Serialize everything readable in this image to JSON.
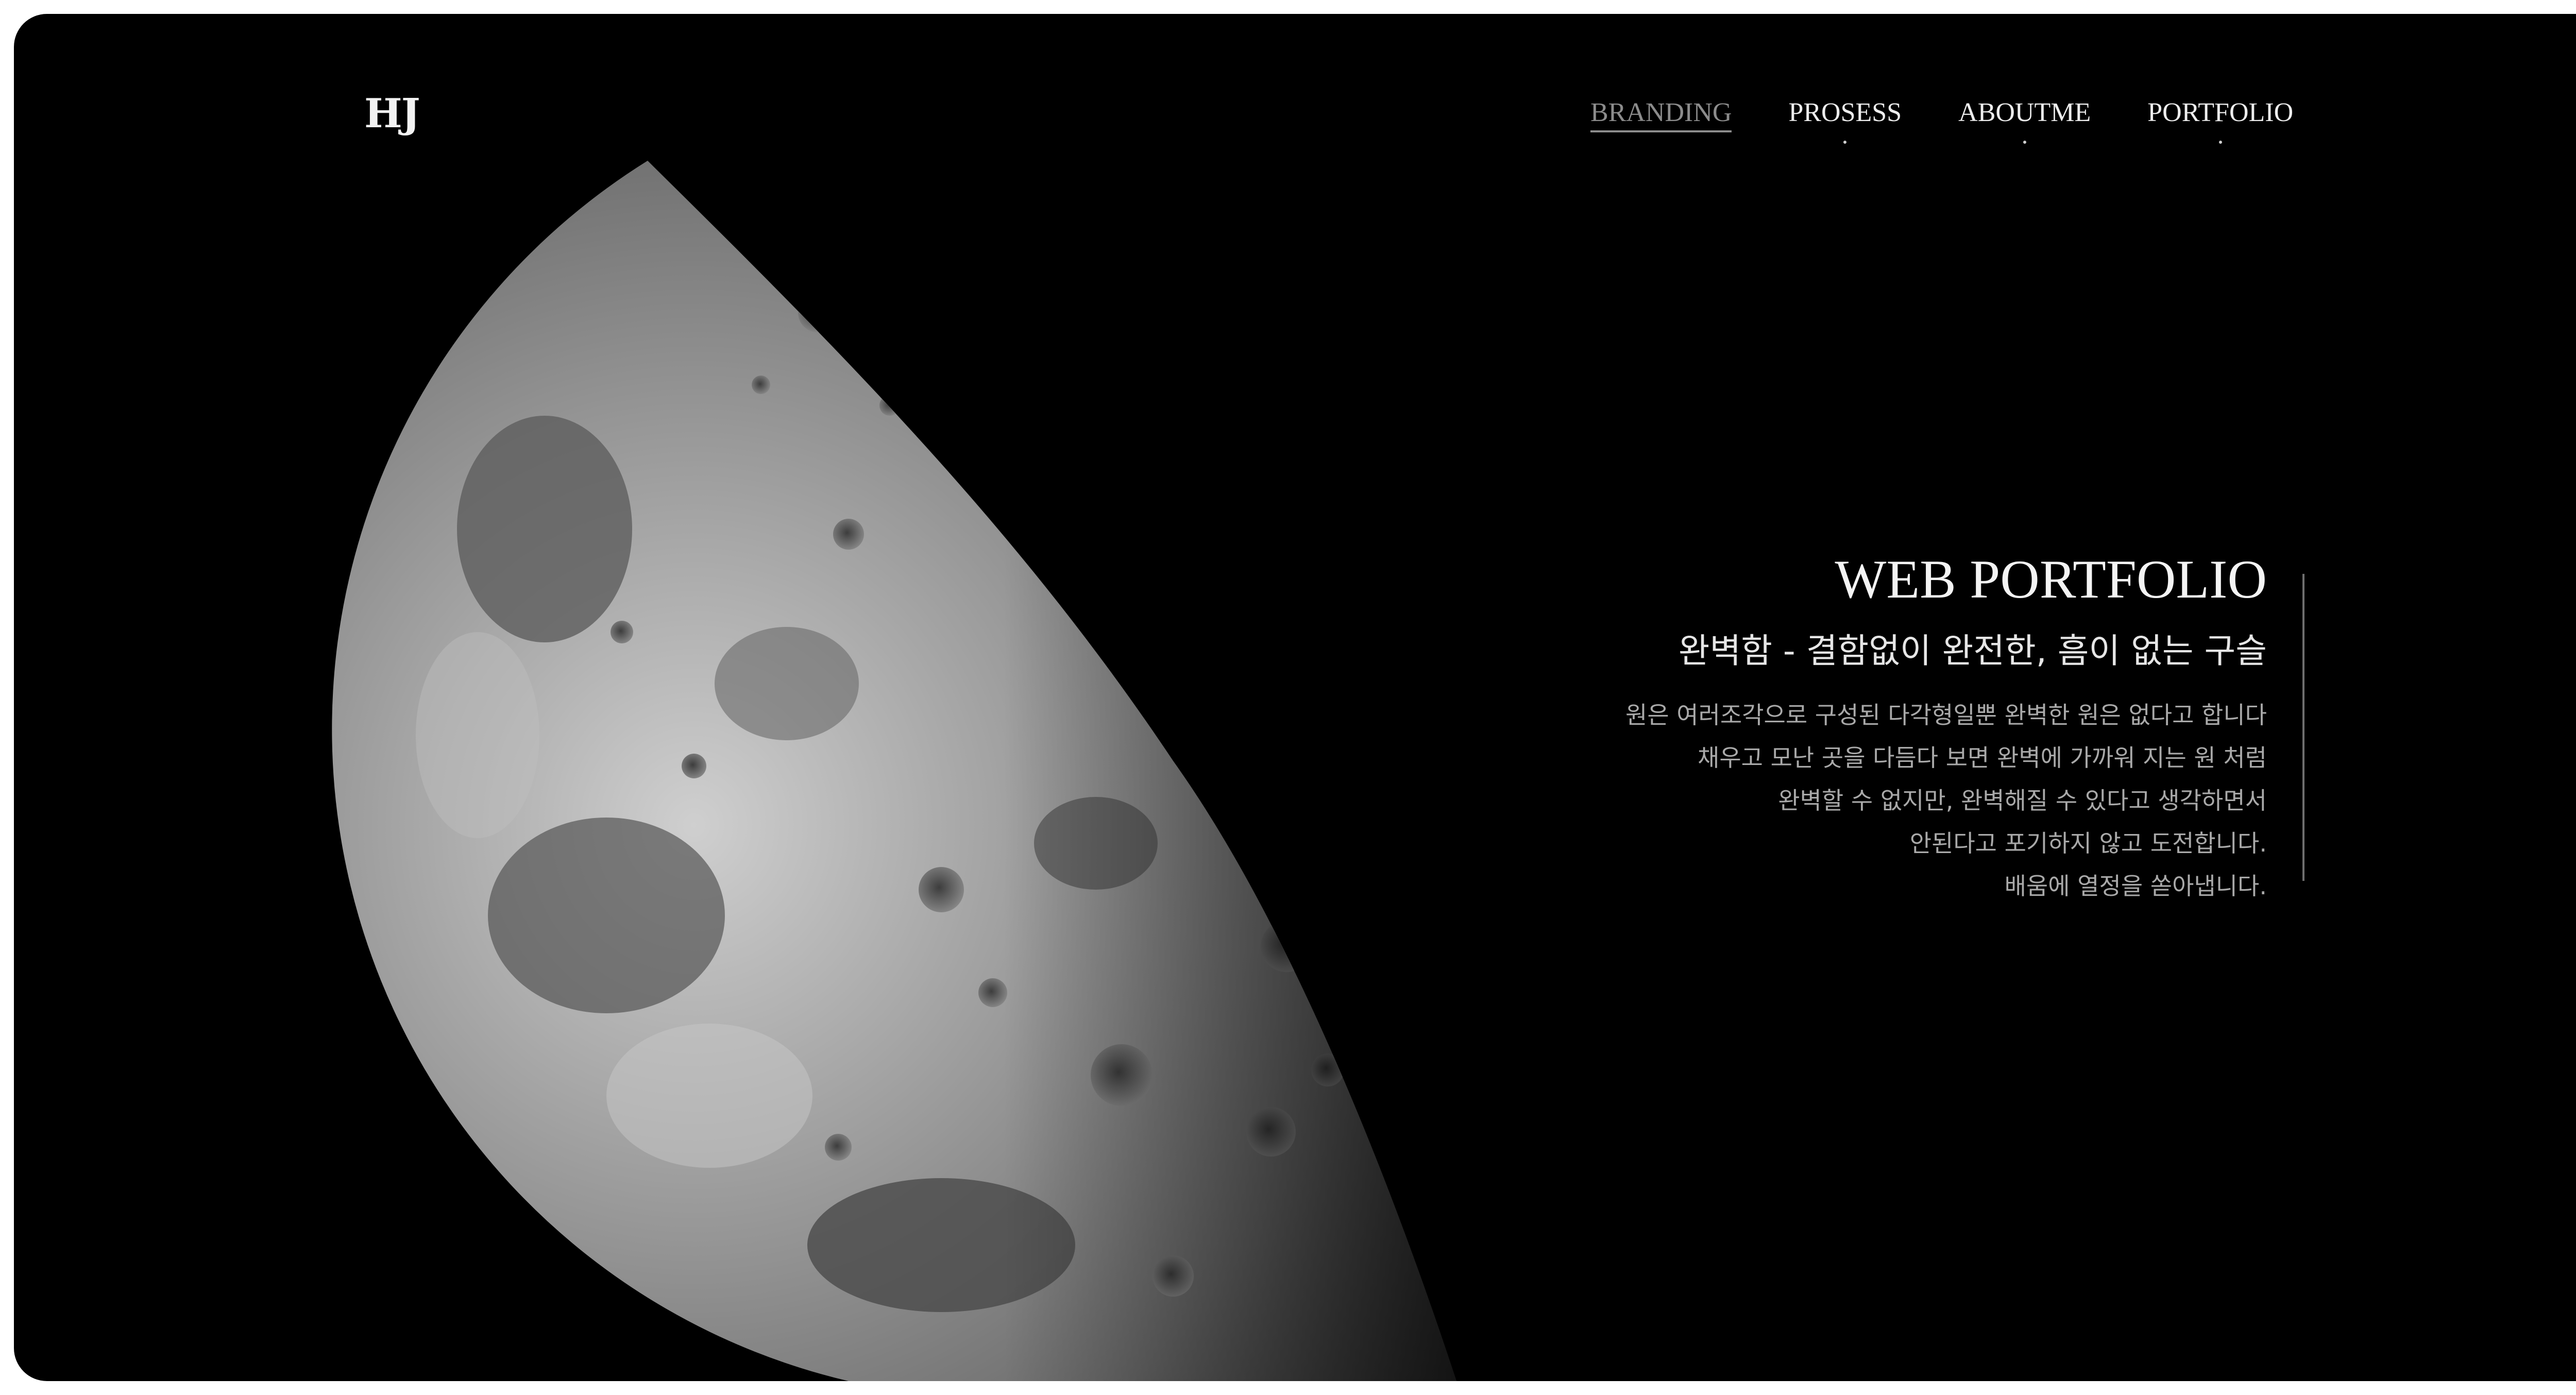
{
  "header": {
    "logo": "HJ",
    "nav": [
      {
        "label": "BRANDING",
        "active": true
      },
      {
        "label": "PROSESS",
        "active": false
      },
      {
        "label": "ABOUTME",
        "active": false
      },
      {
        "label": "PORTFOLIO",
        "active": false
      }
    ]
  },
  "hero": {
    "title": "WEB PORTFOLIO",
    "subtitle": "완벽함 - 결함없이 완전한, 흠이 없는 구슬",
    "body_lines": [
      "원은 여러조각으로 구성된 다각형일뿐 완벽한 원은 없다고 합니다",
      "채우고 모난 곳을 다듬다 보면 완벽에 가까워 지는 원 처럼",
      "완벽할 수 없지만, 완벽해질 수 있다고 생각하면서",
      "안된다고 포기하지 않고 도전합니다.",
      "배움에 열정을 쏟아냅니다."
    ]
  },
  "colors": {
    "background": "#000000",
    "frame": "#ffffff",
    "text_primary": "#f4f4f4",
    "text_muted": "#a9a9a9",
    "nav_active": "#8c8c8c"
  },
  "icons": {
    "moon_image": "moon-image"
  }
}
